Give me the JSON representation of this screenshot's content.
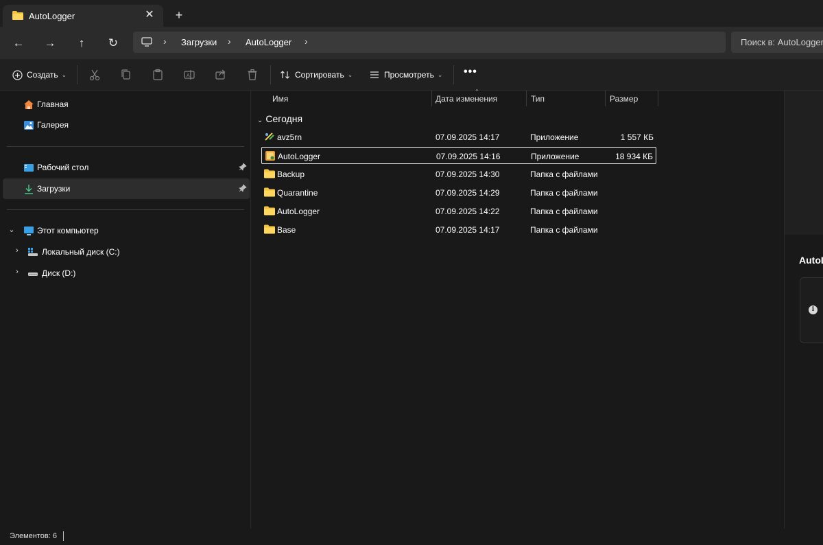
{
  "window": {
    "tab_title": "AutoLogger",
    "close_glyph": "✕",
    "new_tab_glyph": "+"
  },
  "address": {
    "back_glyph": "←",
    "forward_glyph": "→",
    "up_glyph": "↑",
    "refresh_glyph": "↻",
    "sep_glyph": "›",
    "breadcrumbs": [
      "Загрузки",
      "AutoLogger"
    ],
    "search_placeholder": "Поиск в: AutoLogger"
  },
  "toolbar": {
    "create_label": "Создать",
    "sort_label": "Сортировать",
    "view_label": "Просмотреть",
    "more_glyph": "•••",
    "chevron": "⌄",
    "icons": [
      "cut-icon",
      "copy-icon",
      "paste-icon",
      "rename-icon",
      "share-icon",
      "delete-icon"
    ]
  },
  "sidebar": {
    "home": "Главная",
    "gallery": "Галерея",
    "desktop": "Рабочий стол",
    "downloads": "Загрузки",
    "this_pc": "Этот компьютер",
    "drive_c": "Локальный диск (C:)",
    "drive_d": "Диск (D:)",
    "expanded_glyph": "⌄",
    "collapsed_glyph": "›"
  },
  "columns": {
    "name": "Имя",
    "date": "Дата изменения",
    "type": "Тип",
    "size": "Размер",
    "sort_caret": "⌃"
  },
  "group": {
    "label": "Сегодня",
    "chevron": "⌄"
  },
  "files": [
    {
      "name": "avz5rn",
      "date": "07.09.2025 14:17",
      "type": "Приложение",
      "size": "1 557 КБ",
      "icon": "avz-app-icon"
    },
    {
      "name": "AutoLogger",
      "date": "07.09.2025 14:16",
      "type": "Приложение",
      "size": "18 934 КБ",
      "icon": "autologger-app-icon"
    },
    {
      "name": "Backup",
      "date": "07.09.2025 14:30",
      "type": "Папка с файлами",
      "size": "",
      "icon": "folder-icon"
    },
    {
      "name": "Quarantine",
      "date": "07.09.2025 14:29",
      "type": "Папка с файлами",
      "size": "",
      "icon": "folder-icon"
    },
    {
      "name": "AutoLogger",
      "date": "07.09.2025 14:22",
      "type": "Папка с файлами",
      "size": "",
      "icon": "folder-icon"
    },
    {
      "name": "Base",
      "date": "07.09.2025 14:17",
      "type": "Папка с файлами",
      "size": "",
      "icon": "folder-icon"
    }
  ],
  "details": {
    "title": "AutoLogger",
    "info_glyph": "i"
  },
  "status": {
    "items_count": "Элементов: 6"
  },
  "colors": {
    "folder": "#f4c242",
    "accent": "#4cc2ff",
    "selected_bg": "#2d2d2d"
  }
}
